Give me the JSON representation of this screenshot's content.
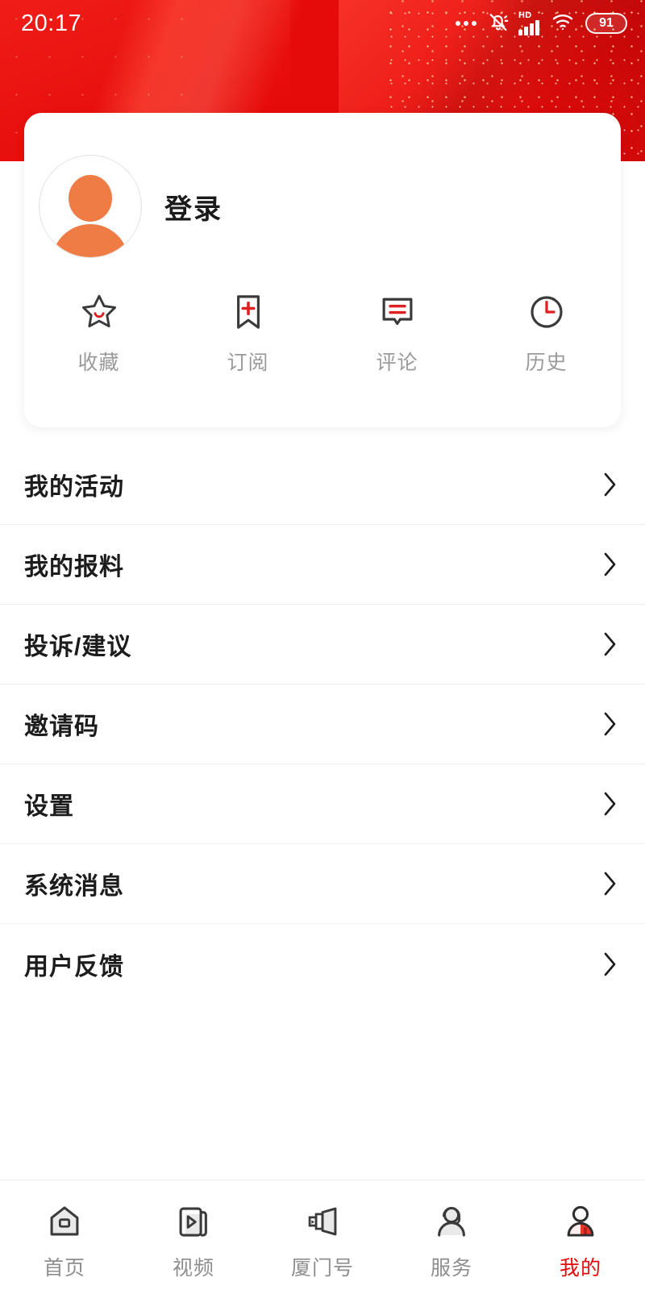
{
  "status_bar": {
    "time": "20:17",
    "dots_icon": "more-dots-icon",
    "mute_icon": "bell-muted-icon",
    "hd_label": "HD",
    "signal_icon": "cellular-signal-icon",
    "wifi_icon": "wifi-icon",
    "battery_level": "91"
  },
  "profile_card": {
    "avatar_icon": "default-avatar-icon",
    "login_label": "登录",
    "quick_actions": [
      {
        "label": "收藏",
        "icon": "star-icon"
      },
      {
        "label": "订阅",
        "icon": "bookmark-plus-icon"
      },
      {
        "label": "评论",
        "icon": "comment-icon"
      },
      {
        "label": "历史",
        "icon": "clock-icon"
      }
    ]
  },
  "menu": {
    "items": [
      {
        "label": "我的活动"
      },
      {
        "label": "我的报料"
      },
      {
        "label": "投诉/建议"
      },
      {
        "label": "邀请码"
      },
      {
        "label": "设置"
      },
      {
        "label": "系统消息"
      },
      {
        "label": "用户反馈"
      }
    ]
  },
  "bottom_nav": {
    "items": [
      {
        "label": "首页",
        "icon": "home-icon",
        "active": false
      },
      {
        "label": "视频",
        "icon": "video-icon",
        "active": false
      },
      {
        "label": "厦门号",
        "icon": "channel-cards-icon",
        "active": false
      },
      {
        "label": "服务",
        "icon": "service-headset-icon",
        "active": false
      },
      {
        "label": "我的",
        "icon": "profile-person-icon",
        "active": true
      }
    ]
  },
  "colors": {
    "brand_red": "#e60b0b",
    "accent_orange": "#ef7b45",
    "icon_red": "#e02020",
    "icon_dark": "#3a3a3a",
    "label_gray": "#9a9a9a"
  }
}
